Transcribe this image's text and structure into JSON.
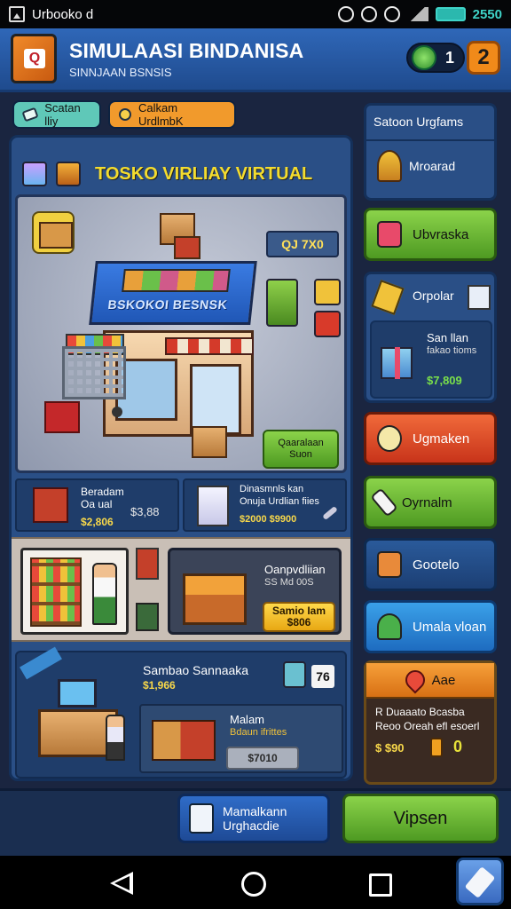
{
  "statusbar": {
    "app_name": "Urbooko d",
    "time": "2550",
    "icons": [
      "image-icon",
      "alarm-icon",
      "clock-icon",
      "wifi-icon",
      "signal-icon",
      "battery-icon"
    ]
  },
  "header": {
    "title": "SIMULAASI BINDANISA",
    "subtitle": "SINNJAAN BSNSIS",
    "coins_value": "1",
    "level_value": "2"
  },
  "pills": {
    "left_label": "Scatan lliy",
    "right_label": "Calkam UrdlmbK"
  },
  "main": {
    "banner_title": "TOSKO VIRLIAY VIRTUAL",
    "store_sign": "BSKOKOI BESNSK",
    "price_tag": "QJ 7X0",
    "scene_button": [
      "Qaaralaan",
      "Suon"
    ],
    "cards_row1": [
      {
        "title": "Beradam",
        "subtitle": "Oa  ual",
        "price": "$2,806",
        "value": "$3,88"
      },
      {
        "title": "Dinasmnls kan",
        "subtitle": "Onuja Urdlian fiies",
        "price": "$2000 $9900"
      }
    ],
    "promo": {
      "title": "Oanpvdliian",
      "subtitle": "SS Md  00S",
      "button": [
        "Samio Iam",
        "$806"
      ]
    },
    "shop_panel": {
      "title": "Sambao Sannaaka",
      "price": "$1,966",
      "count": "76",
      "item_title": "Malam",
      "item_subtitle": "Bdaun ifrittes",
      "button": "$7010"
    }
  },
  "sidebar": {
    "header": "Satoon Urgfams",
    "header_item": "Mroarad",
    "btn_green_1": "Ubvraska",
    "card": {
      "title": "Orpolar",
      "item_title": "San llan",
      "item_subtitle": "fakao tioms",
      "price": "$7,809"
    },
    "btn_red": "Ugmaken",
    "btn_green_2": "Oyrnalm",
    "btn_navy": "Gootelo",
    "btn_blue": "Umala vloan",
    "offer": {
      "title": "Aae",
      "line1": "R  Duaaato Bcasba",
      "line2": "Reoo Oreah efl esoerl",
      "price": "$ $90",
      "count": "0"
    }
  },
  "bottom": {
    "btn_left": [
      "Mamalkann",
      "Urghacdie"
    ],
    "btn_right": "Vipsen"
  },
  "colors": {
    "accent_blue": "#2f67b8",
    "accent_green": "#4e9a22",
    "accent_orange": "#f08a1a",
    "accent_red": "#c8341a",
    "banner_yellow": "#f4dc2e"
  }
}
